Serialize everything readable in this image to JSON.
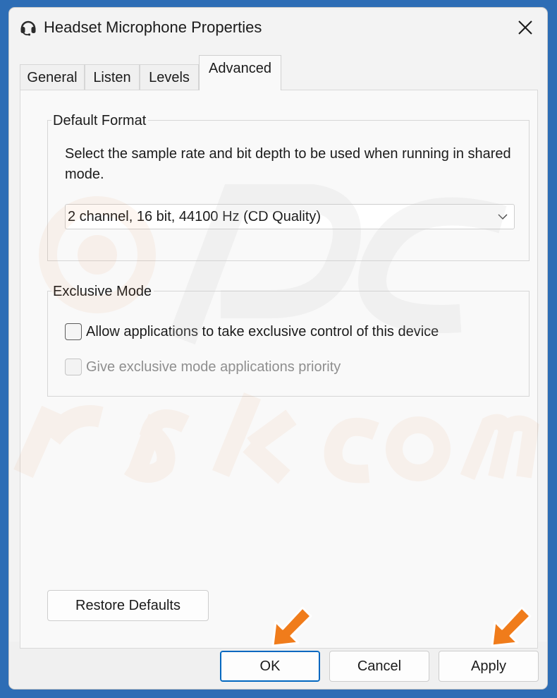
{
  "window": {
    "title": "Headset Microphone Properties",
    "icon": "headset-icon",
    "close_icon": "close-icon"
  },
  "tabs": [
    {
      "label": "General",
      "active": false
    },
    {
      "label": "Listen",
      "active": false
    },
    {
      "label": "Levels",
      "active": false
    },
    {
      "label": "Advanced",
      "active": true
    }
  ],
  "default_format": {
    "group_label": "Default Format",
    "description": "Select the sample rate and bit depth to be used when running in shared mode.",
    "selected_value": "2 channel, 16 bit, 44100 Hz (CD Quality)"
  },
  "exclusive_mode": {
    "group_label": "Exclusive Mode",
    "options": [
      {
        "label": "Allow applications to take exclusive control of this device",
        "checked": false,
        "enabled": true
      },
      {
        "label": "Give exclusive mode applications priority",
        "checked": false,
        "enabled": false
      }
    ]
  },
  "buttons": {
    "restore_defaults": "Restore Defaults",
    "ok": "OK",
    "cancel": "Cancel",
    "apply": "Apply"
  },
  "annotations": {
    "arrow_color": "#f07c1b",
    "arrow_icon": "pointer-arrow-icon"
  },
  "colors": {
    "desktop_background": "#2d6db5",
    "dialog_background": "#f3f3f3",
    "accent": "#0067c0"
  }
}
